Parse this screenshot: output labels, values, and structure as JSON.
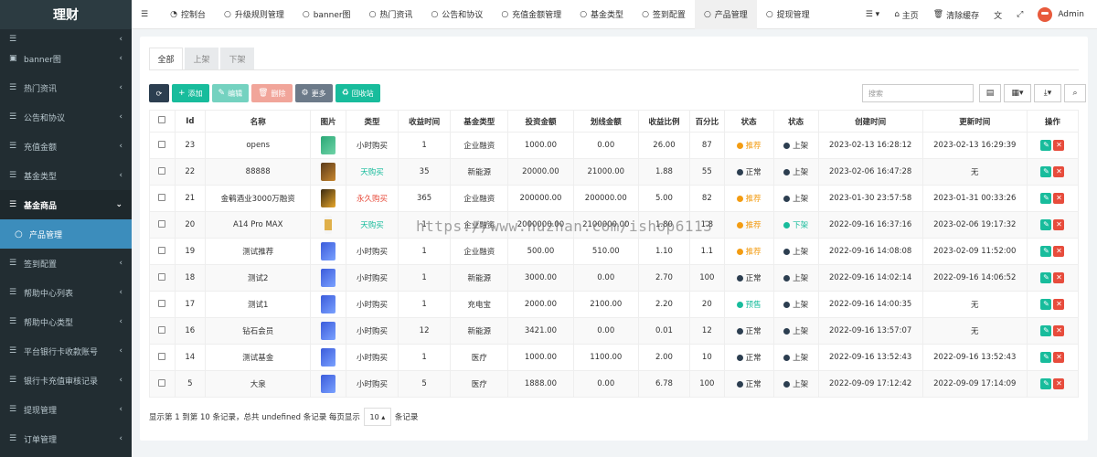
{
  "app": {
    "title": "理财"
  },
  "sidebar": {
    "items": [
      {
        "label": "",
        "icon": "list-icon",
        "partial": true
      },
      {
        "label": "banner图",
        "icon": "image-icon"
      },
      {
        "label": "热门资讯",
        "icon": "list-icon"
      },
      {
        "label": "公告和协议",
        "icon": "list-icon"
      },
      {
        "label": "充值金额",
        "icon": "list-icon"
      },
      {
        "label": "基金类型",
        "icon": "list-icon"
      },
      {
        "label": "基金商品",
        "icon": "list-icon",
        "open": true
      },
      {
        "label": "产品管理",
        "icon": "circle-icon",
        "active": true
      },
      {
        "label": "签到配置",
        "icon": "list-icon"
      },
      {
        "label": "帮助中心列表",
        "icon": "list-icon"
      },
      {
        "label": "帮助中心类型",
        "icon": "list-icon"
      },
      {
        "label": "平台银行卡收款账号",
        "icon": "list-icon"
      },
      {
        "label": "银行卡充值审核记录",
        "icon": "list-icon"
      },
      {
        "label": "提现管理",
        "icon": "list-icon"
      },
      {
        "label": "订单管理",
        "icon": "list-icon"
      }
    ]
  },
  "topbar": {
    "tabs": [
      {
        "label": "控制台",
        "icon": "dashboard-icon"
      },
      {
        "label": "升级规则管理",
        "icon": "circle-icon"
      },
      {
        "label": "banner图",
        "icon": "circle-icon"
      },
      {
        "label": "热门资讯",
        "icon": "circle-icon"
      },
      {
        "label": "公告和协议",
        "icon": "circle-icon"
      },
      {
        "label": "充值金额管理",
        "icon": "circle-icon"
      },
      {
        "label": "基金类型",
        "icon": "circle-icon"
      },
      {
        "label": "签到配置",
        "icon": "circle-icon"
      },
      {
        "label": "产品管理",
        "icon": "circle-icon",
        "current": true
      },
      {
        "label": "提现管理",
        "icon": "circle-icon"
      }
    ],
    "home_label": "主页",
    "clear_cache_label": "清除缓存",
    "user_name": "Admin"
  },
  "status_tabs": [
    "全部",
    "上架",
    "下架"
  ],
  "toolbar": {
    "add_label": "添加",
    "edit_label": "编辑",
    "delete_label": "删除",
    "more_label": "更多",
    "recycle_label": "回收站"
  },
  "search": {
    "placeholder": "搜索"
  },
  "table": {
    "columns": [
      "Id",
      "名称",
      "图片",
      "类型",
      "收益时间",
      "基金类型",
      "投资金额",
      "划线金额",
      "收益比例",
      "百分比",
      "状态",
      "状态",
      "创建时间",
      "更新时间",
      "操作"
    ],
    "rows": [
      {
        "id": "23",
        "name": "opens",
        "img": "green",
        "type": "小时购买",
        "type_color": "#333333",
        "time": "1",
        "fund": "企业融资",
        "invest": "1000.00",
        "line": "0.00",
        "ratio": "26.00",
        "pct": "87",
        "s1": "推荐",
        "s1c": "#f39c12",
        "s2": "上架",
        "s2c": "#2c3e50",
        "created": "2023-02-13 16:28:12",
        "updated": "2023-02-13 16:29:39"
      },
      {
        "id": "22",
        "name": "88888",
        "img": "brown",
        "type": "天购买",
        "type_color": "#18bc9c",
        "time": "35",
        "fund": "新能源",
        "invest": "20000.00",
        "line": "21000.00",
        "ratio": "1.88",
        "pct": "55",
        "s1": "正常",
        "s1c": "#2c3e50",
        "s2": "上架",
        "s2c": "#2c3e50",
        "created": "2023-02-06 16:47:28",
        "updated": "无"
      },
      {
        "id": "21",
        "name": "金鹌酒业3000万融资",
        "img": "gold",
        "type": "永久购买",
        "type_color": "#e74c3c",
        "time": "365",
        "fund": "企业融资",
        "invest": "200000.00",
        "line": "200000.00",
        "ratio": "5.00",
        "pct": "82",
        "s1": "推荐",
        "s1c": "#f39c12",
        "s2": "上架",
        "s2c": "#2c3e50",
        "created": "2023-01-30 23:57:58",
        "updated": "2023-01-31 00:33:26"
      },
      {
        "id": "20",
        "name": "A14 Pro MAX",
        "img": "phone",
        "type": "天购买",
        "type_color": "#18bc9c",
        "time": "1",
        "fund": "企业融资",
        "invest": "2000000.00",
        "line": "2100000.00",
        "ratio": "1.80",
        "pct": "1.8",
        "s1": "推荐",
        "s1c": "#f39c12",
        "s2": "下架",
        "s2c": "#18bc9c",
        "created": "2022-09-16 16:37:16",
        "updated": "2023-02-06 19:17:32"
      },
      {
        "id": "19",
        "name": "测试推荐",
        "img": "blue",
        "type": "小时购买",
        "type_color": "#333333",
        "time": "1",
        "fund": "企业融资",
        "invest": "500.00",
        "line": "510.00",
        "ratio": "1.10",
        "pct": "1.1",
        "s1": "推荐",
        "s1c": "#f39c12",
        "s2": "上架",
        "s2c": "#2c3e50",
        "created": "2022-09-16 14:08:08",
        "updated": "2023-02-09 11:52:00"
      },
      {
        "id": "18",
        "name": "测试2",
        "img": "blue",
        "type": "小时购买",
        "type_color": "#333333",
        "time": "1",
        "fund": "新能源",
        "invest": "3000.00",
        "line": "0.00",
        "ratio": "2.70",
        "pct": "100",
        "s1": "正常",
        "s1c": "#2c3e50",
        "s2": "上架",
        "s2c": "#2c3e50",
        "created": "2022-09-16 14:02:14",
        "updated": "2022-09-16 14:06:52"
      },
      {
        "id": "17",
        "name": "测试1",
        "img": "blue",
        "type": "小时购买",
        "type_color": "#333333",
        "time": "1",
        "fund": "充电宝",
        "invest": "2000.00",
        "line": "2100.00",
        "ratio": "2.20",
        "pct": "20",
        "s1": "预售",
        "s1c": "#18bc9c",
        "s2": "上架",
        "s2c": "#2c3e50",
        "created": "2022-09-16 14:00:35",
        "updated": "无"
      },
      {
        "id": "16",
        "name": "钻石会员",
        "img": "blue",
        "type": "小时购买",
        "type_color": "#333333",
        "time": "12",
        "fund": "新能源",
        "invest": "3421.00",
        "line": "0.00",
        "ratio": "0.01",
        "pct": "12",
        "s1": "正常",
        "s1c": "#2c3e50",
        "s2": "上架",
        "s2c": "#2c3e50",
        "created": "2022-09-16 13:57:07",
        "updated": "无"
      },
      {
        "id": "14",
        "name": "测试基金",
        "img": "blue",
        "type": "小时购买",
        "type_color": "#333333",
        "time": "1",
        "fund": "医疗",
        "invest": "1000.00",
        "line": "1100.00",
        "ratio": "2.00",
        "pct": "10",
        "s1": "正常",
        "s1c": "#2c3e50",
        "s2": "上架",
        "s2c": "#2c3e50",
        "created": "2022-09-16 13:52:43",
        "updated": "2022-09-16 13:52:43"
      },
      {
        "id": "5",
        "name": "大泉",
        "img": "blue",
        "type": "小时购买",
        "type_color": "#333333",
        "time": "5",
        "fund": "医疗",
        "invest": "1888.00",
        "line": "0.00",
        "ratio": "6.78",
        "pct": "100",
        "s1": "正常",
        "s1c": "#2c3e50",
        "s2": "上架",
        "s2c": "#2c3e50",
        "created": "2022-09-09 17:12:42",
        "updated": "2022-09-09 17:14:09"
      }
    ]
  },
  "pagination": {
    "summary": "显示第 1 到第 10 条记录，总共 undefined 条记录 每页显示",
    "page_size": "10",
    "suffix": "条记录"
  },
  "watermark": "https://www.huzhan.com/ishop6113",
  "colors": {
    "sidebar_bg": "#222d32",
    "active_blue": "#3c8dbc",
    "green": "#18bc9c",
    "red": "#e74c3c",
    "orange": "#f39c12",
    "dark": "#2c3e50"
  }
}
